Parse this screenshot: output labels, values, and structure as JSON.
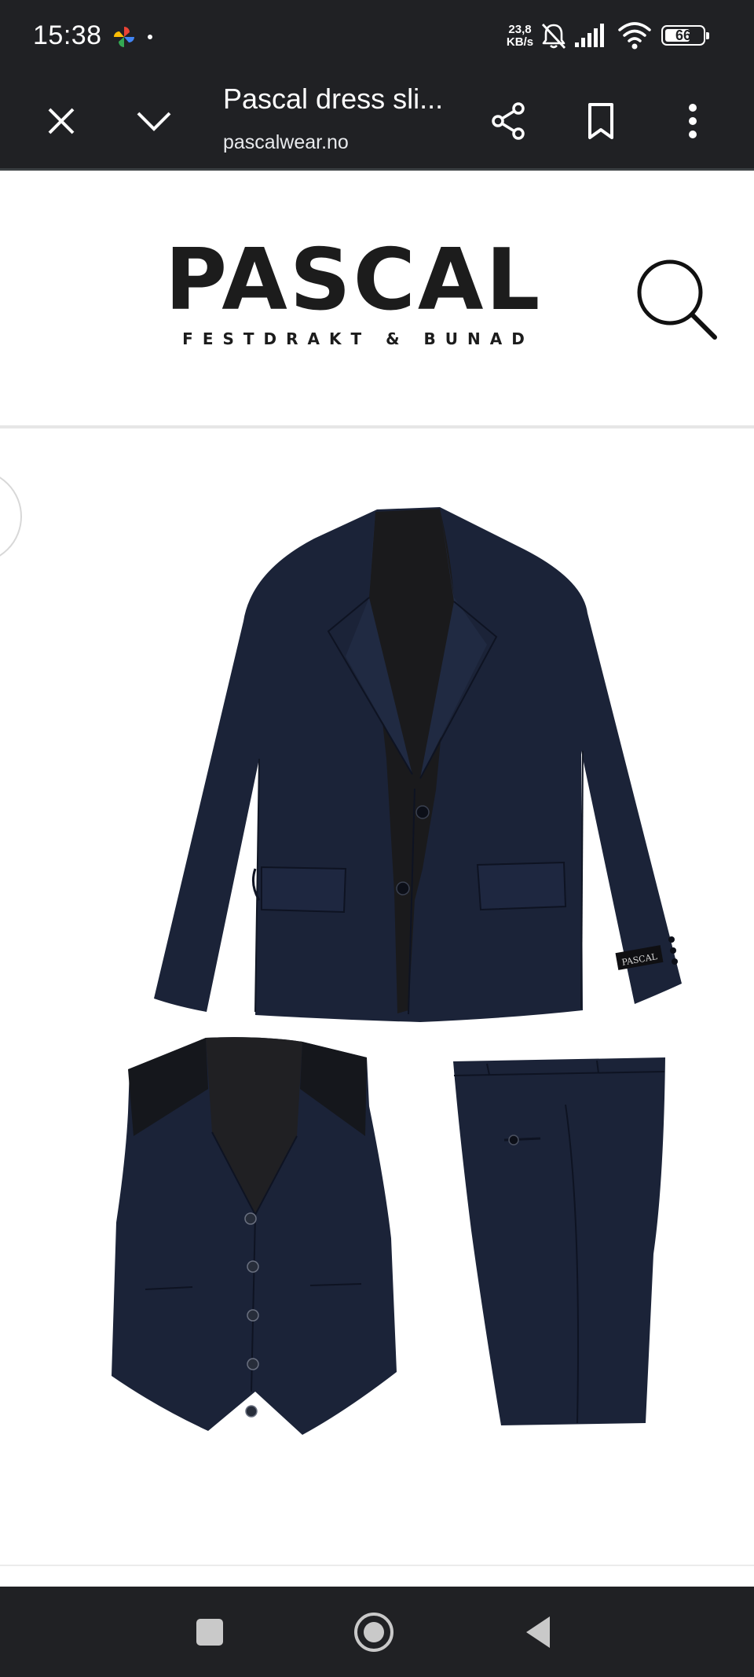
{
  "status_bar": {
    "time": "15:38",
    "network_speed_value": "23,8",
    "network_speed_unit": "KB/s",
    "battery_level": "66",
    "icons": [
      "google-photos-icon",
      "notification-dot",
      "bell-off-icon",
      "cell-signal-icon",
      "wifi-icon",
      "battery-icon"
    ]
  },
  "toolbar": {
    "page_title": "Pascal dress sli...",
    "url": "pascalwear.no",
    "icons": [
      "close-icon",
      "chevron-down-icon",
      "share-icon",
      "bookmark-icon",
      "more-vert-icon"
    ]
  },
  "site": {
    "logo_main": "PASCAL",
    "logo_sub": "FESTDRAKT & BUNAD",
    "icons": [
      "search-icon"
    ]
  },
  "product": {
    "label_text": "PASCAL",
    "suit_color": "#1a2236"
  },
  "nav_bar": {
    "icons": [
      "recents-icon",
      "home-icon",
      "back-icon"
    ]
  },
  "colors": {
    "chrome_dark": "#202124",
    "page_background": "#ffffff",
    "logo_text": "#1c1c1c"
  }
}
